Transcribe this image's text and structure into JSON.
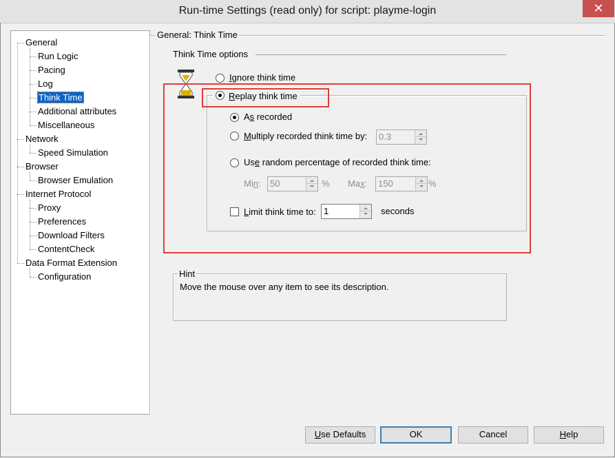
{
  "window": {
    "title": "Run-time Settings (read only) for script: playme-login",
    "close_glyph": "✕"
  },
  "tree": {
    "items": [
      {
        "label": "General",
        "level": 0
      },
      {
        "label": "Run Logic",
        "level": 1
      },
      {
        "label": "Pacing",
        "level": 1
      },
      {
        "label": "Log",
        "level": 1
      },
      {
        "label": "Think Time",
        "level": 1,
        "selected": true
      },
      {
        "label": "Additional attributes",
        "level": 1
      },
      {
        "label": "Miscellaneous",
        "level": 1
      },
      {
        "label": "Network",
        "level": 0
      },
      {
        "label": "Speed Simulation",
        "level": 1
      },
      {
        "label": "Browser",
        "level": 0
      },
      {
        "label": "Browser Emulation",
        "level": 1
      },
      {
        "label": "Internet Protocol",
        "level": 0
      },
      {
        "label": "Proxy",
        "level": 1
      },
      {
        "label": "Preferences",
        "level": 1
      },
      {
        "label": "Download Filters",
        "level": 1
      },
      {
        "label": "ContentCheck",
        "level": 1
      },
      {
        "label": "Data Format Extension",
        "level": 0
      },
      {
        "label": "Configuration",
        "level": 1
      }
    ]
  },
  "panel": {
    "group_title": "General: Think Time",
    "options_title": "Think Time options",
    "hourglass_icon": "hourglass-icon",
    "ignore": {
      "prefix": "",
      "accel": "I",
      "rest": "gnore think time",
      "checked": false
    },
    "replay": {
      "prefix": "",
      "accel": "R",
      "rest": "eplay think time",
      "checked": true
    },
    "as_recorded": {
      "prefix": "A",
      "accel": "s",
      "rest": " recorded",
      "checked": true
    },
    "multiply": {
      "prefix": "",
      "accel": "M",
      "rest": "ultiply recorded think time by:",
      "checked": false,
      "value": "0.3"
    },
    "random": {
      "prefix": "Us",
      "accel": "e",
      "rest": " random percentage of recorded think time:",
      "checked": false
    },
    "min": {
      "prefix": "Mi",
      "accel": "n",
      "rest": ":",
      "value": "50",
      "unit": "%"
    },
    "max": {
      "prefix": "Ma",
      "accel": "x",
      "rest": ":",
      "value": "150",
      "unit": "%"
    },
    "limit": {
      "prefix": "",
      "accel": "L",
      "rest": "imit think time to:",
      "checked": false,
      "value": "1",
      "unit": "seconds"
    }
  },
  "hint": {
    "title": "Hint",
    "text": "Move the mouse over any item to see its description."
  },
  "buttons": {
    "use_defaults": {
      "accel": "U",
      "rest": "se Defaults"
    },
    "ok": "OK",
    "cancel": "Cancel",
    "help": {
      "accel": "H",
      "rest": "elp"
    }
  },
  "colors": {
    "annotation_red": "#e03c3c",
    "selection_blue": "#0a64c8",
    "close_red": "#c75050"
  }
}
